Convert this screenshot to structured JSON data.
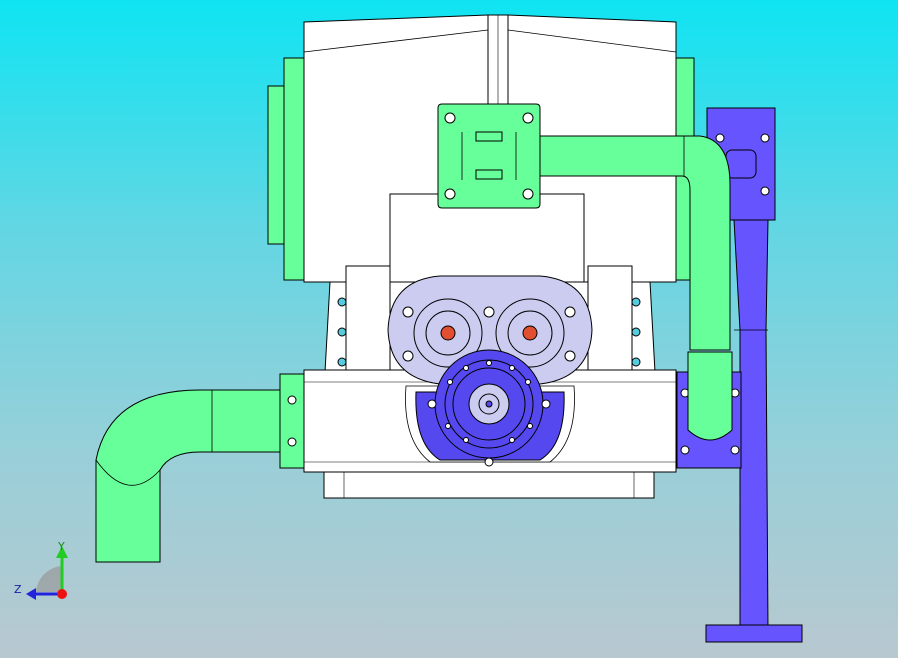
{
  "viewport": {
    "background_top": "#0fe4f2",
    "background_bottom": "#b8c8d0"
  },
  "model_colors": {
    "housing": "#ffffff",
    "outline": "#000000",
    "green_pipe": "#66ff99",
    "blue_pipe": "#6655ff",
    "gear_cover": "#ccccf0",
    "hub": "#5548ee",
    "shaft_dot": "#e05030",
    "bolt_cyan": "#55ccdd"
  },
  "triad": {
    "y_label": "Y",
    "z_label": "Z",
    "y_color": "#22cc22",
    "z_color": "#2222dd",
    "origin_color": "#ee1111"
  }
}
